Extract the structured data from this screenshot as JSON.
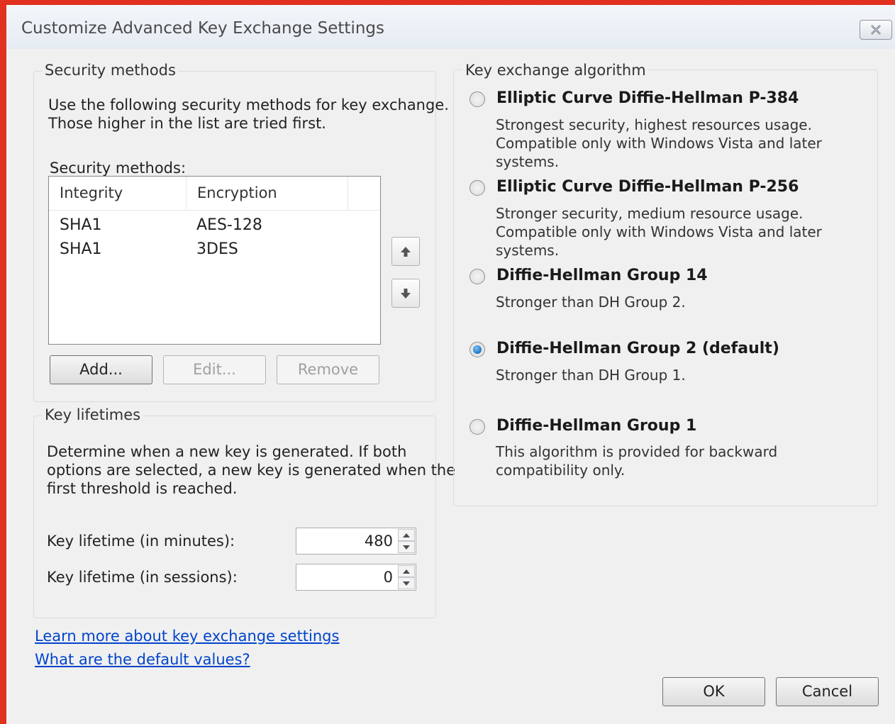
{
  "window": {
    "title": "Customize Advanced Key Exchange Settings",
    "close_icon": "close-icon"
  },
  "security_methods": {
    "legend": "Security methods",
    "description_line1": "Use the following security methods for key exchange.",
    "description_line2": "Those higher in the list are tried first.",
    "list_label": "Security methods:",
    "columns": [
      "Integrity",
      "Encryption"
    ],
    "rows": [
      {
        "integrity": "SHA1",
        "encryption": "AES-128"
      },
      {
        "integrity": "SHA1",
        "encryption": "3DES"
      }
    ],
    "add_label": "Add...",
    "edit_label": "Edit...",
    "remove_label": "Remove",
    "move_up_icon": "arrow-up-icon",
    "move_down_icon": "arrow-down-icon"
  },
  "key_lifetimes": {
    "legend": "Key lifetimes",
    "description_line1": "Determine when a new key is generated. If both",
    "description_line2": "options are selected, a new key is generated when the",
    "description_line3": "first threshold is reached.",
    "minutes_label": "Key lifetime (in minutes):",
    "minutes_value": "480",
    "sessions_label": "Key lifetime (in sessions):",
    "sessions_value": "0"
  },
  "algorithm": {
    "legend": "Key exchange algorithm",
    "selected": "dh-group-2",
    "options": [
      {
        "id": "ecdh-p384",
        "title": "Elliptic Curve Diffie-Hellman P-384",
        "desc": [
          "Strongest security, highest resources usage.",
          "Compatible only with Windows Vista and later",
          "systems."
        ]
      },
      {
        "id": "ecdh-p256",
        "title": "Elliptic Curve Diffie-Hellman P-256",
        "desc": [
          "Stronger security, medium resource usage.",
          "Compatible only with Windows Vista and later",
          "systems."
        ]
      },
      {
        "id": "dh-group-14",
        "title": "Diffie-Hellman Group 14",
        "desc": [
          "Stronger than DH Group 2."
        ]
      },
      {
        "id": "dh-group-2",
        "title": "Diffie-Hellman Group 2 (default)",
        "desc": [
          "Stronger than DH Group 1."
        ]
      },
      {
        "id": "dh-group-1",
        "title": "Diffie-Hellman Group 1",
        "desc": [
          "This algorithm is provided for backward",
          "compatibility only."
        ]
      }
    ]
  },
  "links": {
    "learn_more": "Learn more about key exchange settings",
    "defaults": "What are the default values?"
  },
  "footer": {
    "ok_label": "OK",
    "cancel_label": "Cancel"
  }
}
